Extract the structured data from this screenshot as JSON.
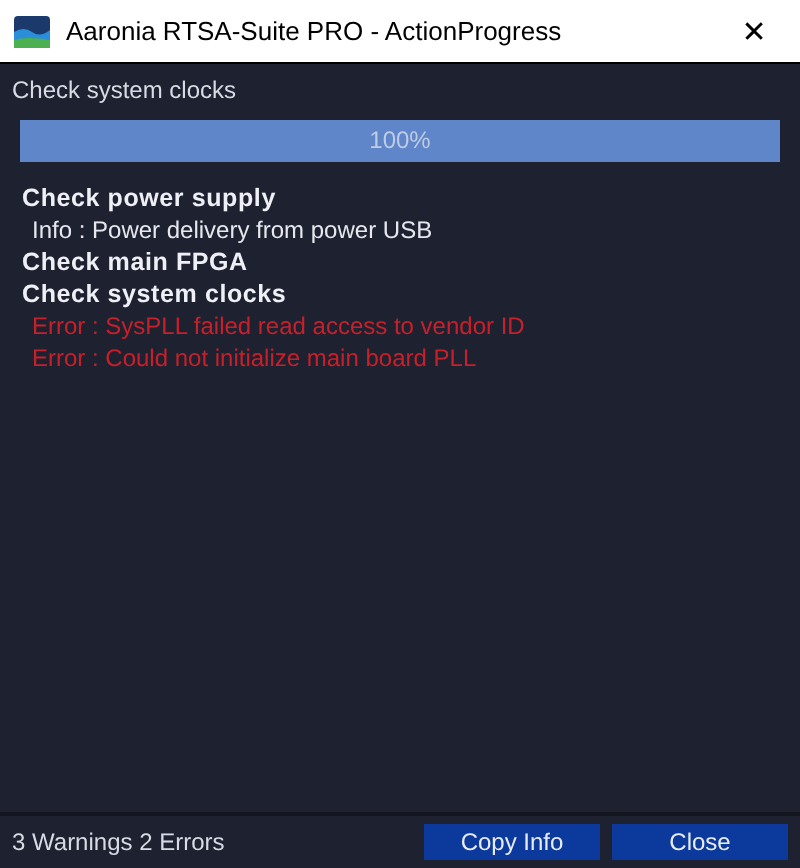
{
  "window": {
    "title": "Aaronia RTSA-Suite PRO - ActionProgress",
    "close": "✕"
  },
  "current_step": "Check system clocks",
  "progress": {
    "level": 1.0,
    "reading": "100%"
  },
  "log": [
    {
      "kind": "heading",
      "text": "Check power supply"
    },
    {
      "kind": "info",
      "text": "Info : Power delivery from power USB"
    },
    {
      "kind": "heading",
      "text": "Check main FPGA"
    },
    {
      "kind": "heading",
      "text": "Check system clocks"
    },
    {
      "kind": "error",
      "text": "Error : SysPLL failed read access to vendor ID"
    },
    {
      "kind": "error",
      "text": "Error : Could not initialize main board PLL"
    }
  ],
  "status_bar": {
    "summary": "3 Warnings 2 Errors",
    "buttons": [
      "Copy Info",
      "Close"
    ]
  }
}
